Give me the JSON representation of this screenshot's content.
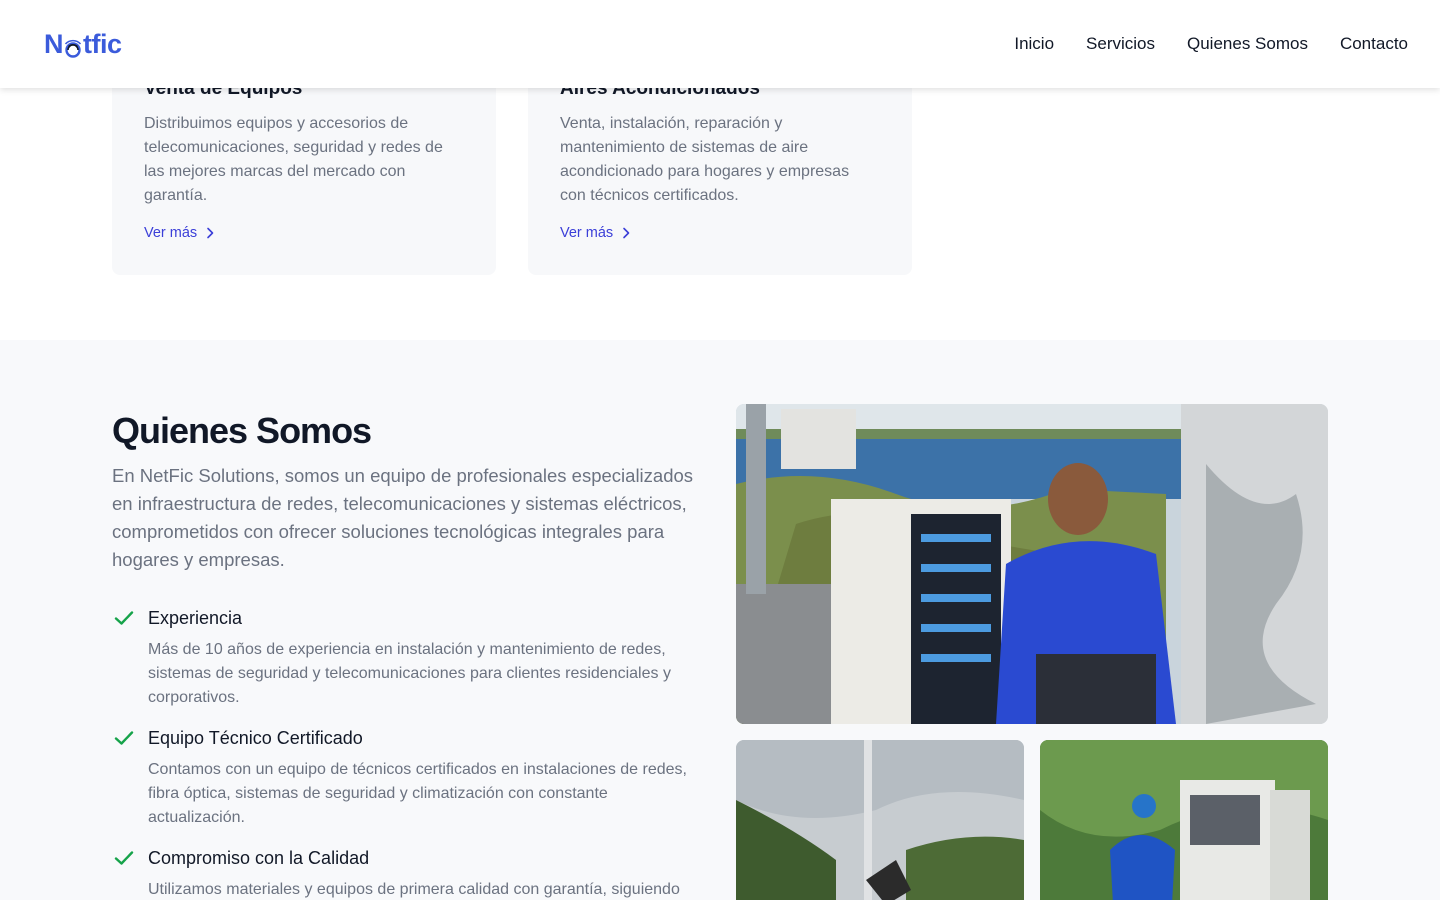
{
  "header": {
    "logo_text_start": "N",
    "logo_text_end": "tfic",
    "nav": [
      "Inicio",
      "Servicios",
      "Quienes Somos",
      "Contacto"
    ]
  },
  "services": {
    "cards": [
      {
        "title": "Venta de Equipos",
        "description": "Distribuimos equipos y accesorios de telecomunicaciones, seguridad y redes de las mejores marcas del mercado con garantía.",
        "link": "Ver más"
      },
      {
        "title": "Aires Acondicionados",
        "description": "Venta, instalación, reparación y mantenimiento de sistemas de aire acondicionado para hogares y empresas con técnicos certificados.",
        "link": "Ver más"
      }
    ]
  },
  "about": {
    "title": "Quienes Somos",
    "lead": "En NetFic Solutions, somos un equipo de profesionales especializados en infraestructura de redes, telecomunicaciones y sistemas eléctricos, comprometidos con ofrecer soluciones tecnológicas integrales para hogares y empresas.",
    "features": [
      {
        "title": "Experiencia",
        "description": "Más de 10 años de experiencia en instalación y mantenimiento de redes, sistemas de seguridad y telecomunicaciones para clientes residenciales y corporativos."
      },
      {
        "title": "Equipo Técnico Certificado",
        "description": "Contamos con un equipo de técnicos certificados en instalaciones de redes, fibra óptica, sistemas de seguridad y climatización con constante actualización."
      },
      {
        "title": "Compromiso con la Calidad",
        "description": "Utilizamos materiales y equipos de primera calidad con garantía, siguiendo"
      }
    ]
  },
  "colors": {
    "brand": "#3b5bdb",
    "link": "#3b3fd8",
    "check": "#16a34a",
    "section_bg": "#f8f9fb"
  }
}
